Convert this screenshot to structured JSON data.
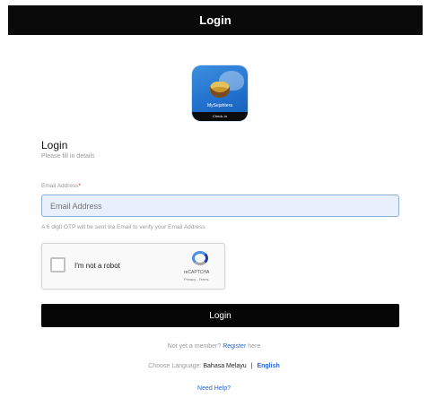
{
  "header": {
    "title": "Login"
  },
  "app_icon": {
    "brand": "MySejahtera",
    "tag": "Check-In"
  },
  "form": {
    "title": "Login",
    "subtitle": "Please fill in details",
    "email_label": "Email Address",
    "email_required_marker": "*",
    "email_placeholder": "Email Address",
    "otp_note": "A 6 digit OTP will be sent via Email to verify your Email Address"
  },
  "captcha": {
    "label": "I'm not a robot",
    "brand": "reCAPTCHA",
    "links": "Privacy - Terms"
  },
  "login_button": "Login",
  "footer": {
    "member_prefix": "Not yet a member? ",
    "register_link": "Register",
    "member_suffix": " here",
    "language_label": "Choose Language: ",
    "language_bm": "Bahasa Melayu",
    "language_sep": "|",
    "language_en": "English",
    "help": "Need Help?"
  }
}
